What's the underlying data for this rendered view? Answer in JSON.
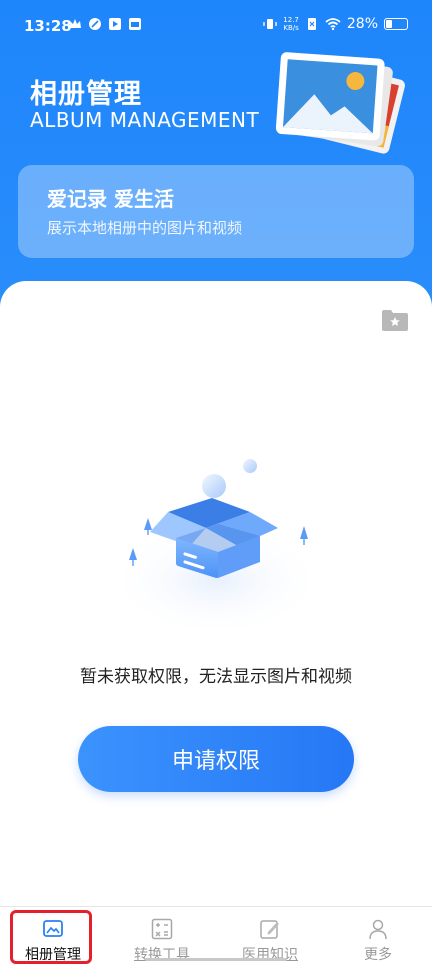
{
  "status_bar": {
    "time": "13:28",
    "net_speed_value": "12.7",
    "net_speed_unit": "KB/s",
    "battery": "28%"
  },
  "header": {
    "title": "相册管理",
    "subtitle": "ALBUM MANAGEMENT"
  },
  "slogan": {
    "title": "爱记录 爱生活",
    "description": "展示本地相册中的图片和视频"
  },
  "empty_state": {
    "message": "暂未获取权限，无法显示图片和视频",
    "button_label": "申请权限"
  },
  "bottom_nav": {
    "items": [
      {
        "label": "相册管理",
        "icon": "album-icon",
        "active": true
      },
      {
        "label": "转换工具",
        "icon": "calculator-icon",
        "active": false
      },
      {
        "label": "医用知识",
        "icon": "edit-icon",
        "active": false
      },
      {
        "label": "更多",
        "icon": "person-icon",
        "active": false
      }
    ]
  },
  "colors": {
    "primary": "#1e86fb",
    "button": "#2677f5",
    "highlight_frame": "#e3202c"
  }
}
